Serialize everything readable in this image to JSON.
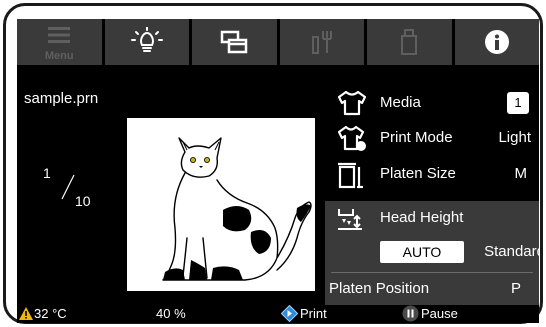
{
  "toolbar": {
    "menu_label": "Menu",
    "items": [
      {
        "icon": "menu-icon",
        "label": "Menu",
        "enabled": false
      },
      {
        "icon": "maintenance-light-icon",
        "enabled": true
      },
      {
        "icon": "job-list-icon",
        "enabled": true
      },
      {
        "icon": "ink-status-icon",
        "enabled": false
      },
      {
        "icon": "usb-drive-icon",
        "enabled": false
      },
      {
        "icon": "info-icon",
        "enabled": true
      }
    ]
  },
  "job": {
    "filename": "sample.prn",
    "current_copy": "1",
    "total_copies": "10"
  },
  "settings": {
    "media_label": "Media",
    "media_value": "1",
    "print_mode_label": "Print Mode",
    "print_mode_value": "Light",
    "platen_size_label": "Platen Size",
    "platen_size_value": "M",
    "head_height_label": "Head Height",
    "head_height_mode": "AUTO",
    "head_height_value": "Standard",
    "platen_position_label": "Platen Position",
    "platen_position_value": "P"
  },
  "status_bar": {
    "temperature": "32 °C",
    "progress": "40 %",
    "print_label": "Print",
    "pause_label": "Pause"
  },
  "colors": {
    "background": "#000000",
    "toolbar_button": "#3a3a3a",
    "panel": "#3a3a3a",
    "warning": "#f2b705",
    "print_button": "#2e8bd8",
    "pause_button": "#4a4a4a"
  }
}
